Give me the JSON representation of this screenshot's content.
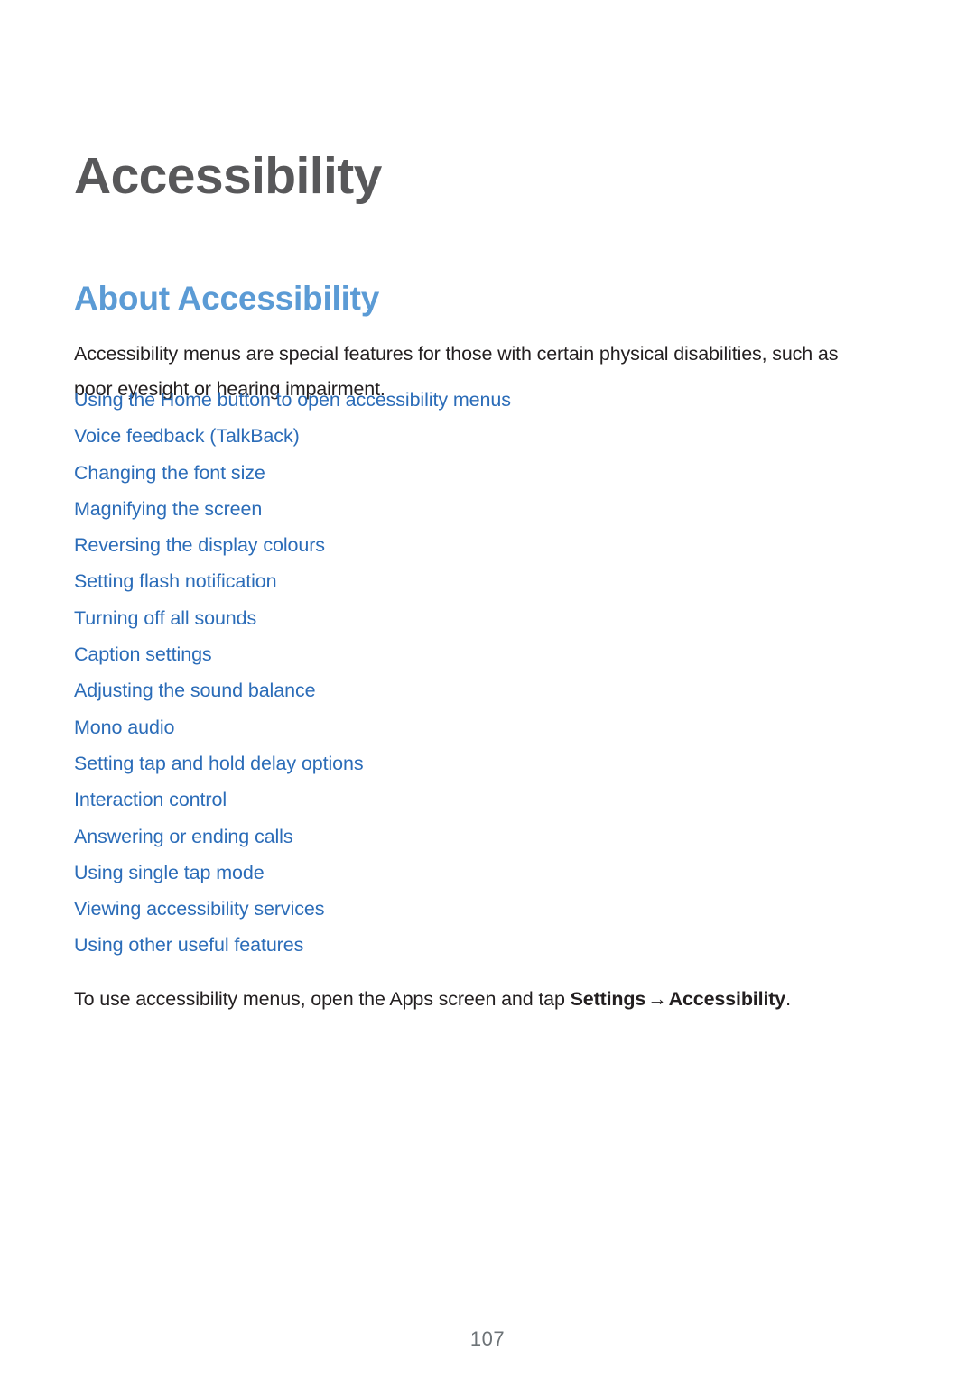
{
  "document": {
    "chapter_title": "Accessibility",
    "section_heading": "About Accessibility",
    "intro_paragraph": "Accessibility menus are special features for those with certain physical disabilities, such as poor eyesight or hearing impairment.",
    "toc_links": [
      {
        "label": "Using the Home button to open accessibility menus"
      },
      {
        "label": "Voice feedback (TalkBack)"
      },
      {
        "label": "Changing the font size"
      },
      {
        "label": "Magnifying the screen"
      },
      {
        "label": "Reversing the display colours"
      },
      {
        "label": "Setting flash notification"
      },
      {
        "label": "Turning off all sounds"
      },
      {
        "label": "Caption settings"
      },
      {
        "label": "Adjusting the sound balance"
      },
      {
        "label": "Mono audio"
      },
      {
        "label": "Setting tap and hold delay options"
      },
      {
        "label": "Interaction control"
      },
      {
        "label": "Answering or ending calls"
      },
      {
        "label": "Using single tap mode"
      },
      {
        "label": "Viewing accessibility services"
      },
      {
        "label": "Using other useful features"
      }
    ],
    "closing_paragraph": {
      "text_before": "To use accessibility menus, open the Apps screen and tap ",
      "bold_first": "Settings",
      "arrow": "→",
      "bold_second": "Accessibility",
      "text_after": "."
    },
    "page_number": "107",
    "colors": {
      "chapter_title": "#58585a",
      "section_heading": "#5b9bd5",
      "link": "#2b6cb8",
      "body_text": "#231f20",
      "page_number": "#6d7377",
      "background": "#ffffff"
    }
  }
}
